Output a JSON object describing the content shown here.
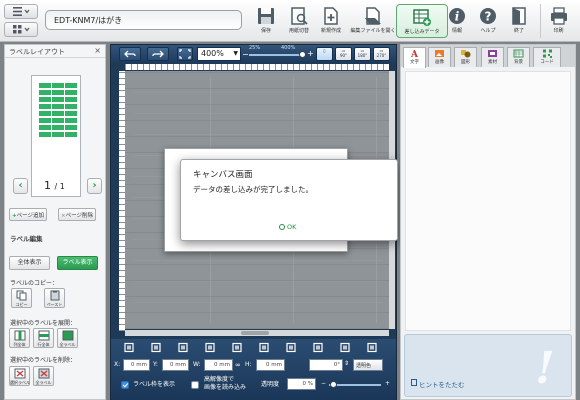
{
  "app": {
    "document_title": "EDT-KNM7/はがき"
  },
  "toolbar": {
    "items": [
      {
        "icon": "save-icon",
        "label": "保存"
      },
      {
        "icon": "paper-switch-icon",
        "label": "用紙切替"
      },
      {
        "icon": "new-doc-icon",
        "label": "新規作成"
      },
      {
        "icon": "open-file-icon",
        "label": "編集ファイルを開く"
      },
      {
        "icon": "merge-data-icon",
        "label": "差し込みデータ"
      },
      {
        "icon": "info-icon",
        "label": "情報"
      },
      {
        "icon": "help-icon",
        "label": "ヘルプ"
      },
      {
        "icon": "exit-icon",
        "label": "終了"
      },
      {
        "icon": "print-icon",
        "label": "印刷"
      }
    ]
  },
  "left_panel": {
    "title": "ラベルレイアウト",
    "close": "×",
    "page_current": "1",
    "page_total": "/ 1",
    "add_page": "ページ追加",
    "delete_page": "ページ削除",
    "label_edit_title": "ラベル編集",
    "show_all": "全体表示",
    "show_label": "ラベル表示",
    "copy_title": "ラベルのコピー：",
    "copy": "コピー",
    "paste": "ペースト",
    "expand_title": "選択中のラベルを展開：",
    "expand": [
      "列全体",
      "行全体",
      "全ラベル"
    ],
    "delete_title": "選択中のラベルを削除：",
    "delete": [
      "選択ラベル",
      "全ラベル"
    ]
  },
  "canvas": {
    "zoom": "400%",
    "zoom_min": "25%",
    "zoom_max": "400%",
    "zoom_fraction": 1.0,
    "views": [
      "",
      "90°",
      "180°",
      "270°"
    ],
    "x_label": "X:",
    "x_value": "0",
    "x_unit": "mm",
    "y_label": "Y:",
    "y_value": "0",
    "y_unit": "mm",
    "w_label": "W:",
    "w_value": "0",
    "w_unit": "mm",
    "h_label": "H:",
    "h_value": "0",
    "h_unit": "mm",
    "angle": "0°",
    "transparent_color": "透明色",
    "show_label_frame": "ラベル枠を表示",
    "hires_line1": "高解像度で",
    "hires_line2": "画像を読み込み",
    "transparency_label": "透明度",
    "transparency_value": "0",
    "transparency_unit": "%"
  },
  "dialog": {
    "title": "キャンバス画面",
    "message": "データの差し込みが完了しました。",
    "ok": "OK"
  },
  "right_panel": {
    "tabs": [
      "文字",
      "画像",
      "図形",
      "素材",
      "背景",
      "コード"
    ],
    "hint": "ヒントをたたむ",
    "hint_mark": "!"
  },
  "colors": {
    "accent_green": "#2b9b52",
    "canvas_navy": "#1f3a56",
    "label_cell_green": "#32b266"
  }
}
